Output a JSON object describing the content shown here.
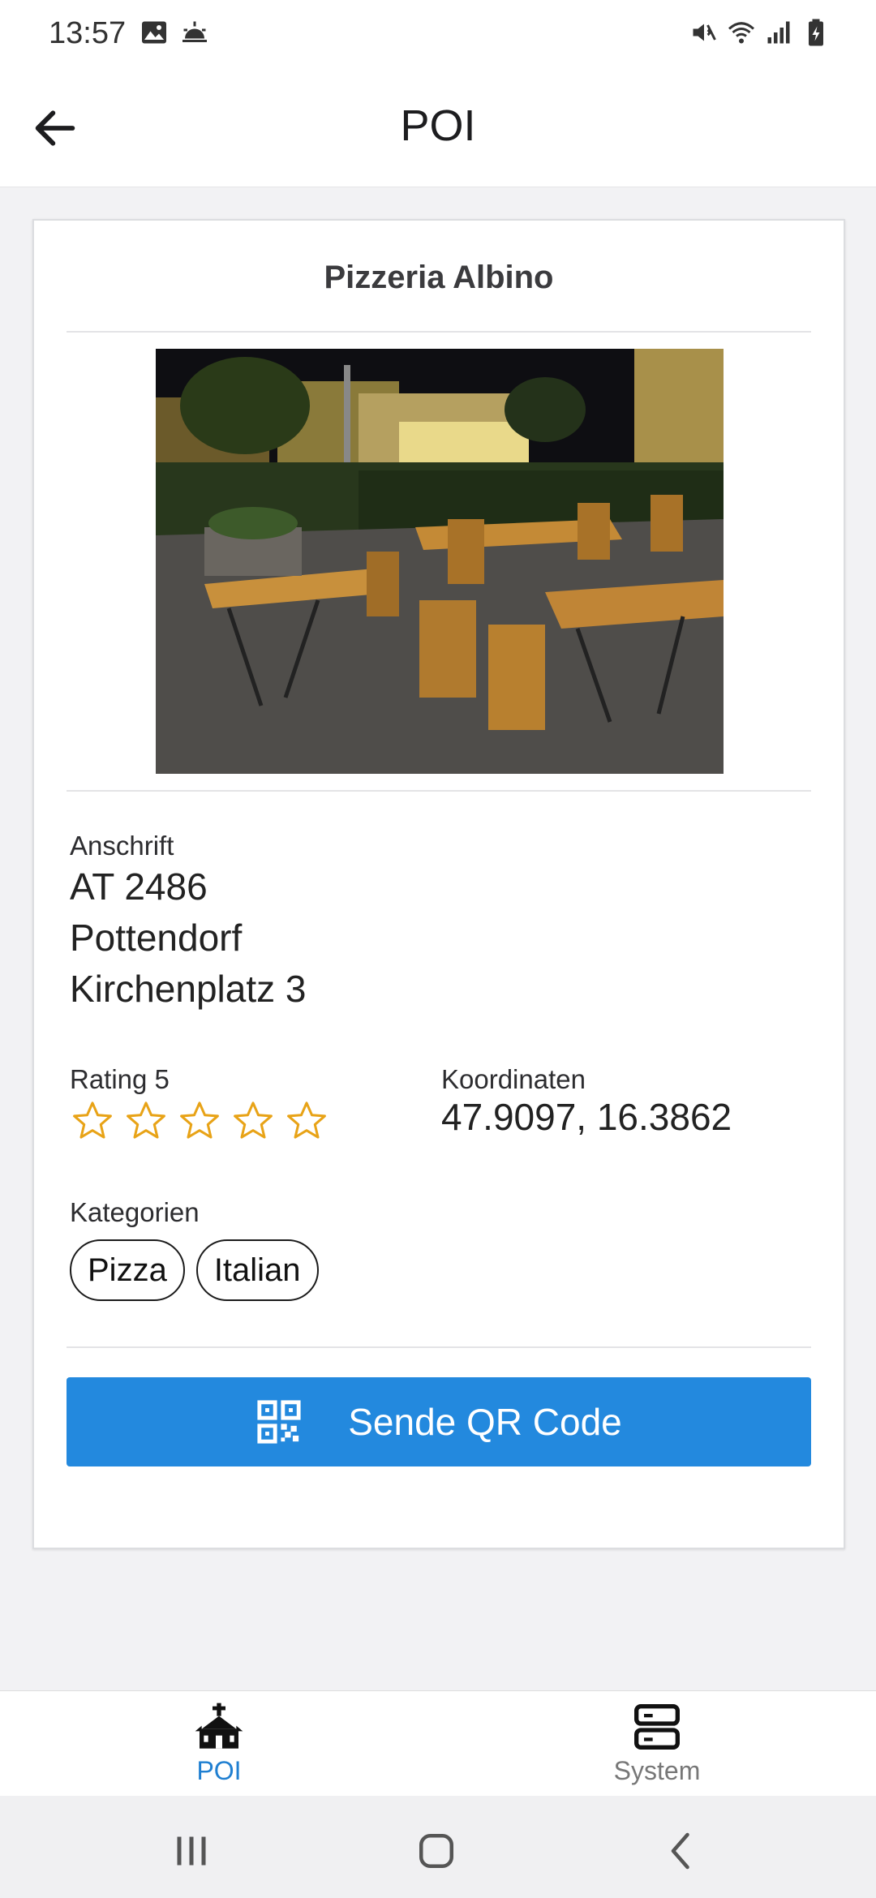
{
  "status_bar": {
    "time": "13:57",
    "left_icons": [
      "image-icon",
      "weather-icon"
    ],
    "right_icons": [
      "mute-icon",
      "wifi-icon",
      "signal-icon",
      "battery-icon"
    ]
  },
  "app_bar": {
    "title": "POI",
    "back_icon": "arrow-left-icon"
  },
  "poi": {
    "name": "Pizzeria Albino",
    "address_label": "Anschrift",
    "address_lines": [
      "AT 2486",
      "Pottendorf",
      "Kirchenplatz 3"
    ],
    "rating_label": "Rating 5",
    "rating_stars": 5,
    "rating_filled": 0,
    "coordinates_label": "Koordinaten",
    "coordinates": "47.9097, 16.3862",
    "categories_label": "Kategorien",
    "categories": [
      "Pizza",
      "Italian"
    ]
  },
  "action": {
    "qr_button_label": "Sende QR Code",
    "qr_icon": "qr-code-icon"
  },
  "bottom_nav": {
    "items": [
      {
        "label": "POI",
        "icon": "church-icon",
        "active": true
      },
      {
        "label": "System",
        "icon": "server-icon",
        "active": false
      }
    ]
  },
  "colors": {
    "accent": "#2389de",
    "star": "#e8a317",
    "nav_active": "#1f7fd1",
    "nav_inactive": "#777777"
  }
}
